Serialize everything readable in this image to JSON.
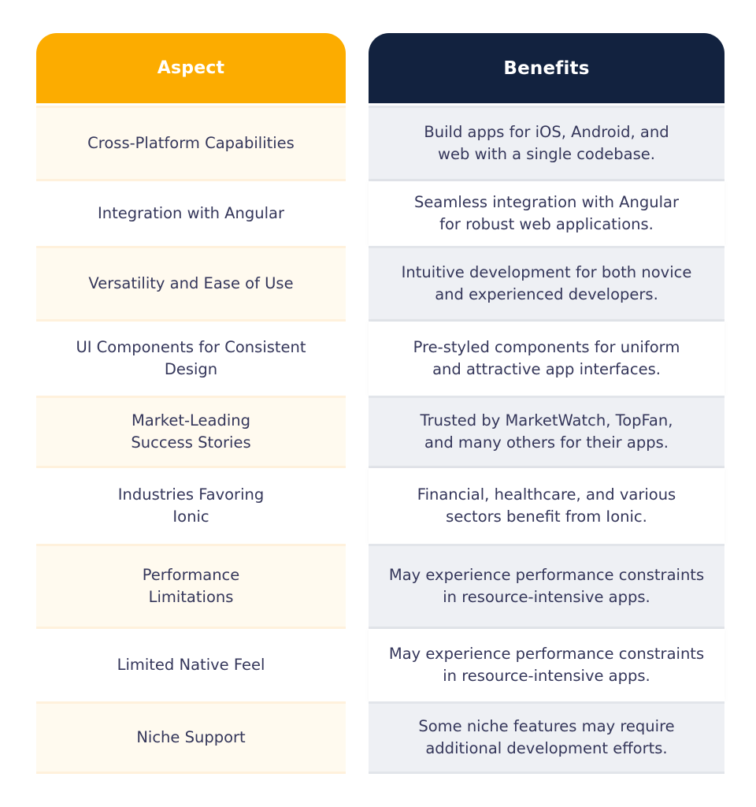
{
  "table": {
    "headers": {
      "aspect": "Aspect",
      "benefits": "Benefits"
    },
    "colors": {
      "aspect_header": "#fcac00",
      "benefits_header": "#12223f",
      "aspect_shaded_row": "#fffaef",
      "benefits_shaded_row": "#eef0f4",
      "text": "#34365a"
    },
    "rows": [
      {
        "aspect": "Cross-Platform Capabilities",
        "benefit": "Build apps for iOS, Android, and web with a single codebase."
      },
      {
        "aspect": "Integration with Angular",
        "benefit": "Seamless integration with Angular for robust web applications."
      },
      {
        "aspect": "Versatility and Ease of Use",
        "benefit": "Intuitive development for both novice and experienced developers."
      },
      {
        "aspect": "UI Components for Consistent Design",
        "benefit": "Pre-styled components for uniform and attractive app interfaces."
      },
      {
        "aspect": "Market-Leading Success Stories",
        "benefit": "Trusted by MarketWatch, TopFan, and many others for their apps."
      },
      {
        "aspect": "Industries Favoring Ionic",
        "benefit": "Financial, healthcare, and various sectors benefit from Ionic."
      },
      {
        "aspect": "Performance Limitations",
        "benefit": "May experience performance constraints in resource-intensive apps."
      },
      {
        "aspect": "Limited Native Feel",
        "benefit": "May experience performance constraints in resource-intensive apps."
      },
      {
        "aspect": "Niche Support",
        "benefit": "Some niche features may require additional development efforts."
      }
    ]
  }
}
